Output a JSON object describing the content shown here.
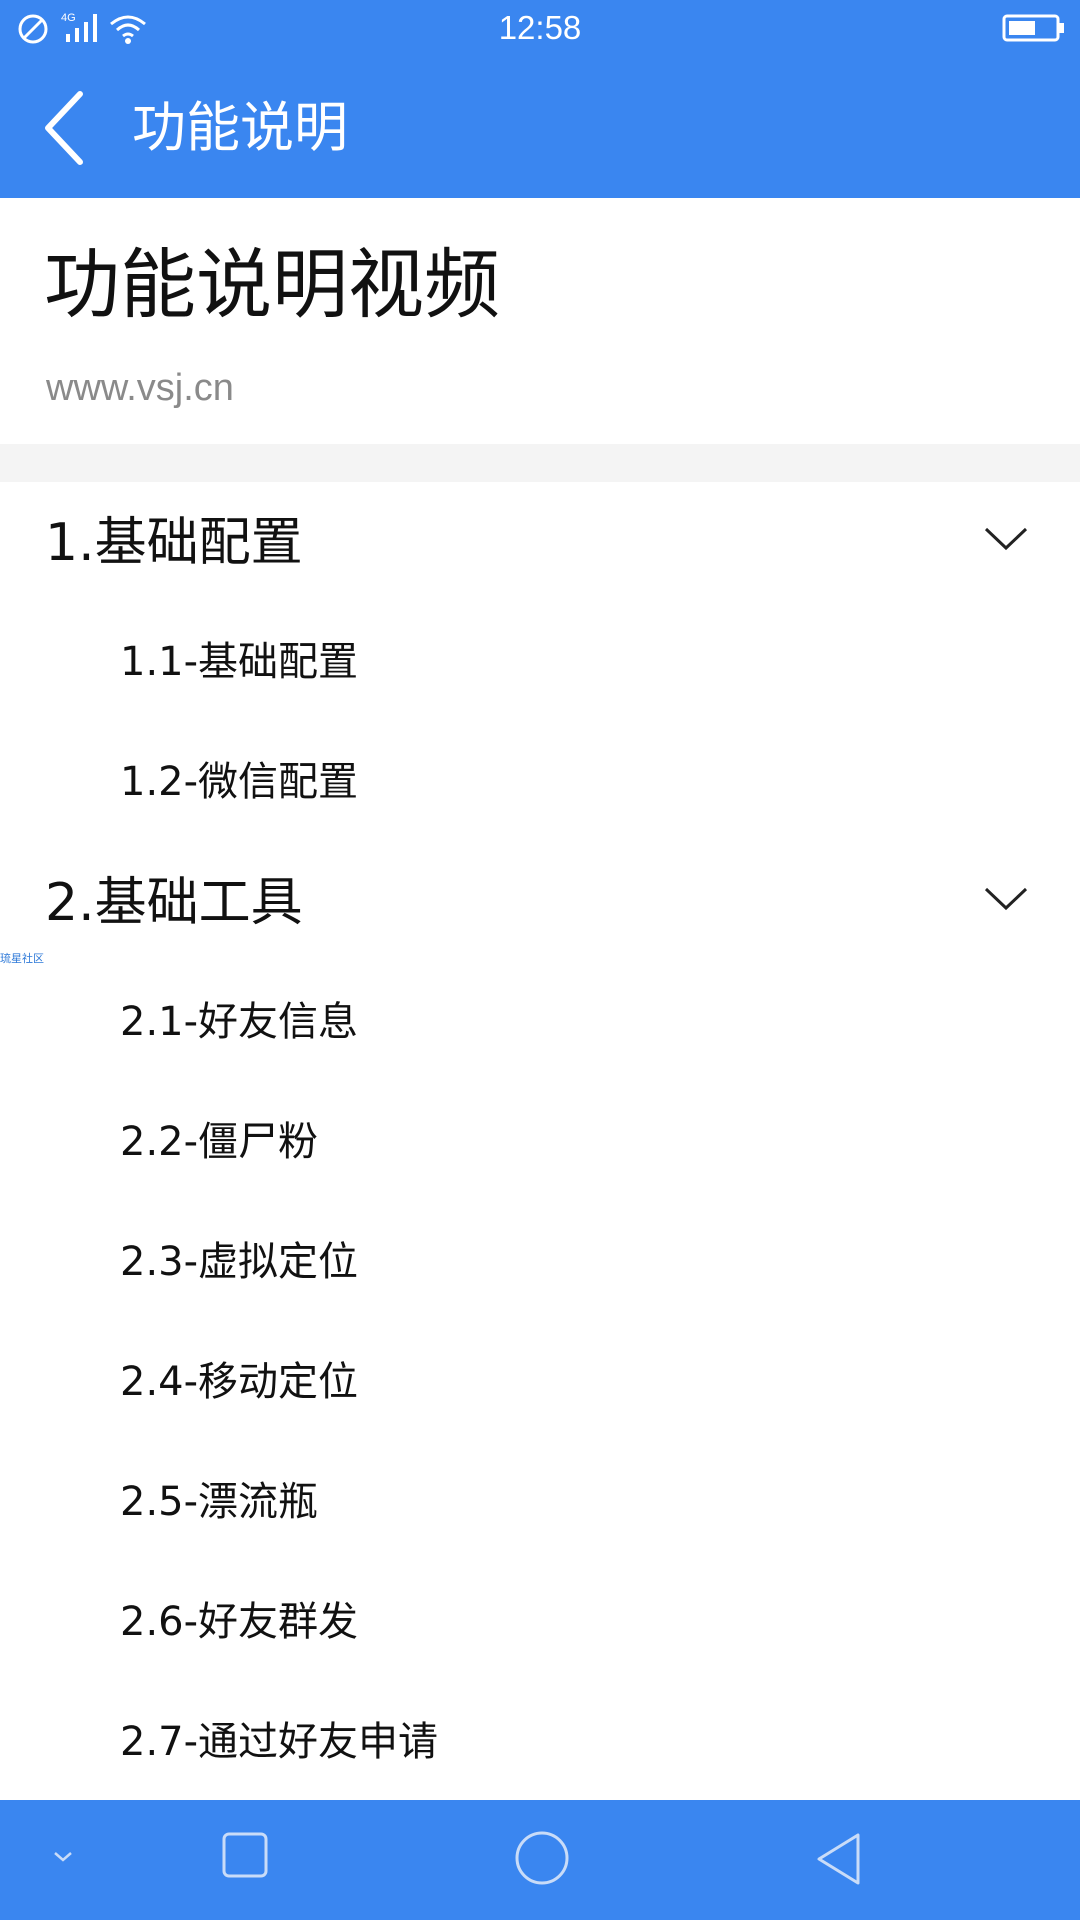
{
  "status_bar": {
    "time": "12:58",
    "icons": [
      "do-not-disturb-icon",
      "4g-signal-icon",
      "wifi-icon",
      "battery-icon"
    ],
    "network_label": "4G"
  },
  "app_bar": {
    "title": "功能说明",
    "back_icon": "chevron-left-icon"
  },
  "header": {
    "title": "功能说明视频",
    "url": "www.vsj.cn"
  },
  "sections": [
    {
      "title": "1.基础配置",
      "expanded_icon": "chevron-down-icon",
      "items": [
        "1.1-基础配置",
        "1.2-微信配置"
      ]
    },
    {
      "title": "2.基础工具",
      "expanded_icon": "chevron-down-icon",
      "items": [
        "2.1-好友信息",
        "2.2-僵尸粉",
        "2.3-虚拟定位",
        "2.4-移动定位",
        "2.5-漂流瓶",
        "2.6-好友群发",
        "2.7-通过好友申请"
      ]
    }
  ],
  "watermark": "琉星社区",
  "nav_bar": {
    "icons": [
      "collapse-down-icon",
      "recent-apps-icon",
      "home-icon",
      "back-triangle-icon"
    ]
  },
  "colors": {
    "primary": "#3a86f0",
    "text": "#111111",
    "muted": "#8a8a8a",
    "band": "#f4f4f4"
  }
}
